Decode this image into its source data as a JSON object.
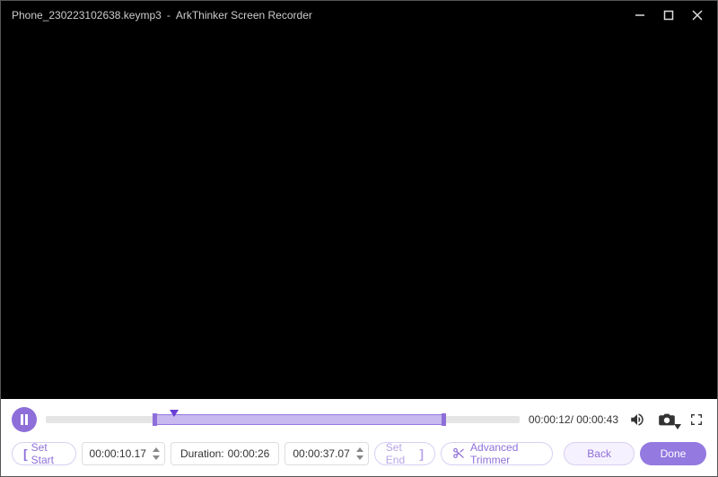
{
  "title": {
    "filename": "Phone_230223102638.keymp3",
    "sep": "-",
    "app": "ArkThinker Screen Recorder"
  },
  "playback": {
    "current": "00:00:12",
    "total": "00:00:43",
    "sep": "/ "
  },
  "timeline": {
    "selectionStartPct": 23,
    "selectionEndPct": 84,
    "playheadPct": 27
  },
  "trim": {
    "setStart": "Set Start",
    "startTime": "00:00:10.17",
    "durationLabel": "Duration:",
    "durationValue": "00:00:26",
    "endTime": "00:00:37.07",
    "setEnd": "Set End",
    "advanced": "Advanced Trimmer"
  },
  "buttons": {
    "back": "Back",
    "done": "Done"
  }
}
